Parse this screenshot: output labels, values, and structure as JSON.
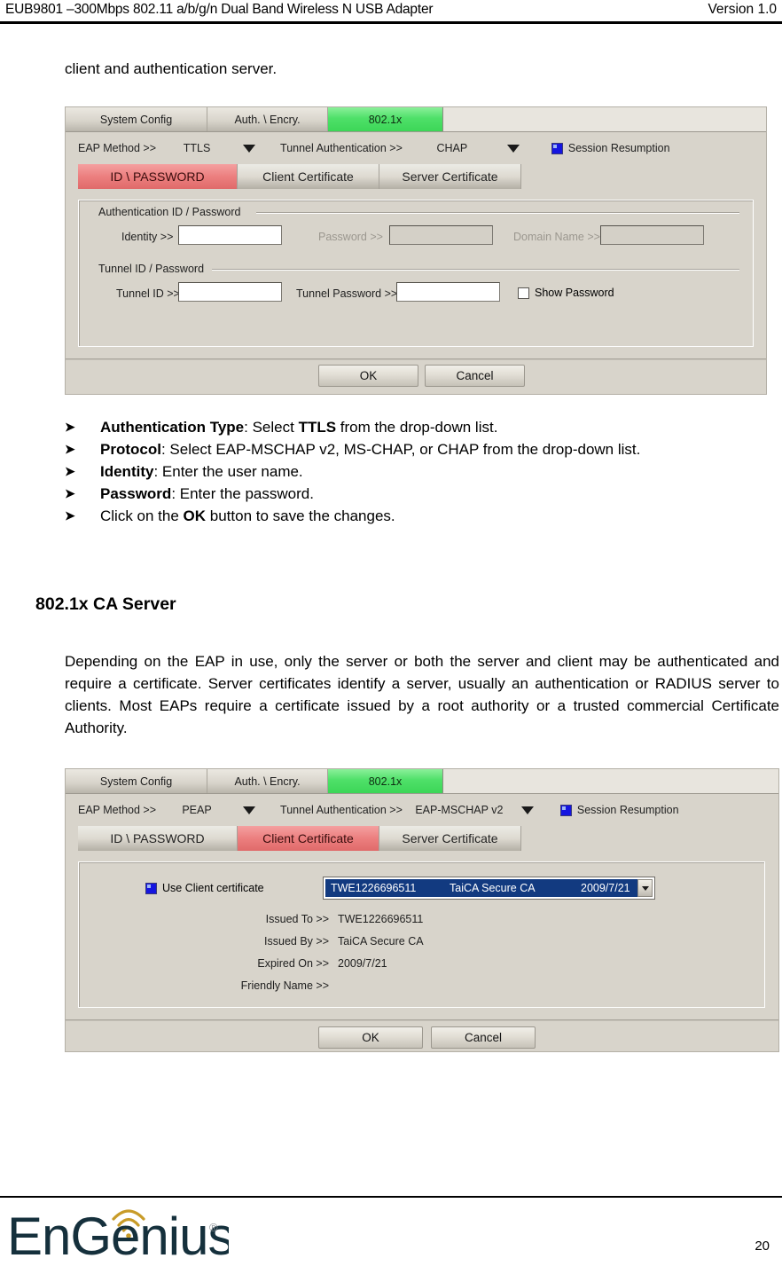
{
  "header": {
    "title": "EUB9801 –300Mbps 802.11 a/b/g/n Dual Band Wireless N USB Adapter",
    "version": "Version 1.0"
  },
  "intro_line": "client and authentication server.",
  "bullets": [
    {
      "marker": "➤",
      "parts": [
        {
          "text": "Authentication Type",
          "bold": true
        },
        {
          "text": ": Select ",
          "bold": false
        },
        {
          "text": "TTLS",
          "bold": true
        },
        {
          "text": " from the drop-down list.",
          "bold": false
        }
      ]
    },
    {
      "marker": "➤",
      "justify": true,
      "parts": [
        {
          "text": "Protocol",
          "bold": true
        },
        {
          "text": ": Select EAP-MSCHAP v2, MS-CHAP, or CHAP from the drop-down list.",
          "bold": false
        }
      ]
    },
    {
      "marker": "➤",
      "parts": [
        {
          "text": "Identity",
          "bold": true
        },
        {
          "text": ": Enter the user name.",
          "bold": false
        }
      ]
    },
    {
      "marker": "➤",
      "parts": [
        {
          "text": "Password",
          "bold": true
        },
        {
          "text": ": Enter the password.",
          "bold": false
        }
      ]
    },
    {
      "marker": "➤",
      "parts": [
        {
          "text": "Click on the ",
          "bold": false
        },
        {
          "text": "OK",
          "bold": true
        },
        {
          "text": " button to save the changes.",
          "bold": false
        }
      ]
    }
  ],
  "section_heading": "802.1x CA Server",
  "ca_paragraph": "Depending on the EAP in use, only the server or both the server and client may be authenticated and require a certificate. Server certificates identify a server, usually an authentication or RADIUS server to clients. Most EAPs require a certificate issued by a root authority or a trusted commercial Certificate Authority.",
  "dialog1": {
    "tabs": [
      {
        "label": "System Config",
        "active": false
      },
      {
        "label": "Auth. \\ Encry.",
        "active": false
      },
      {
        "label": "802.1x",
        "active": true
      }
    ],
    "eap_method_label": "EAP Method >>",
    "eap_method_value": "TTLS",
    "tunnel_auth_label": "Tunnel Authentication >>",
    "tunnel_auth_value": "CHAP",
    "session_resumption_label": "Session Resumption",
    "session_resumption_checked": true,
    "subtabs": [
      {
        "label": "ID \\ PASSWORD",
        "active": true
      },
      {
        "label": "Client Certificate",
        "active": false
      },
      {
        "label": "Server Certificate",
        "active": false
      }
    ],
    "group_auth_legend": "Authentication ID / Password",
    "identity_label": "Identity >>",
    "identity_value": "",
    "password_label": "Password >>",
    "password_value": "",
    "domain_name_label": "Domain Name >>",
    "domain_name_value": "",
    "group_tunnel_legend": "Tunnel ID / Password",
    "tunnel_id_label": "Tunnel ID >>",
    "tunnel_id_value": "",
    "tunnel_password_label": "Tunnel Password >>",
    "tunnel_password_value": "",
    "show_password_label": "Show Password",
    "show_password_checked": false,
    "ok_label": "OK",
    "cancel_label": "Cancel"
  },
  "dialog2": {
    "tabs": [
      {
        "label": "System Config",
        "active": false
      },
      {
        "label": "Auth. \\ Encry.",
        "active": false
      },
      {
        "label": "802.1x",
        "active": true
      }
    ],
    "eap_method_label": "EAP Method >>",
    "eap_method_value": "PEAP",
    "tunnel_auth_label": "Tunnel Authentication >>",
    "tunnel_auth_value": "EAP-MSCHAP v2",
    "session_resumption_label": "Session Resumption",
    "session_resumption_checked": true,
    "subtabs": [
      {
        "label": "ID \\ PASSWORD",
        "active": false
      },
      {
        "label": "Client Certificate",
        "active": true
      },
      {
        "label": "Server Certificate",
        "active": false
      }
    ],
    "use_client_cert_label": "Use Client certificate",
    "use_client_cert_checked": true,
    "cert_combo": {
      "col1": "TWE1226696511",
      "col2": "TaiCA Secure CA",
      "col3": "2009/7/21"
    },
    "details": [
      {
        "label": "Issued To >>",
        "value": "TWE1226696511"
      },
      {
        "label": "Issued By >>",
        "value": "TaiCA Secure CA"
      },
      {
        "label": "Expired On >>",
        "value": "2009/7/21"
      },
      {
        "label": "Friendly Name >>",
        "value": ""
      }
    ],
    "ok_label": "OK",
    "cancel_label": "Cancel"
  },
  "footer": {
    "logo_text": "EnGenius",
    "logo_registered": "®",
    "logo_color": "#15303c",
    "logo_arc_color": "#c89b28",
    "page_number": "20"
  }
}
